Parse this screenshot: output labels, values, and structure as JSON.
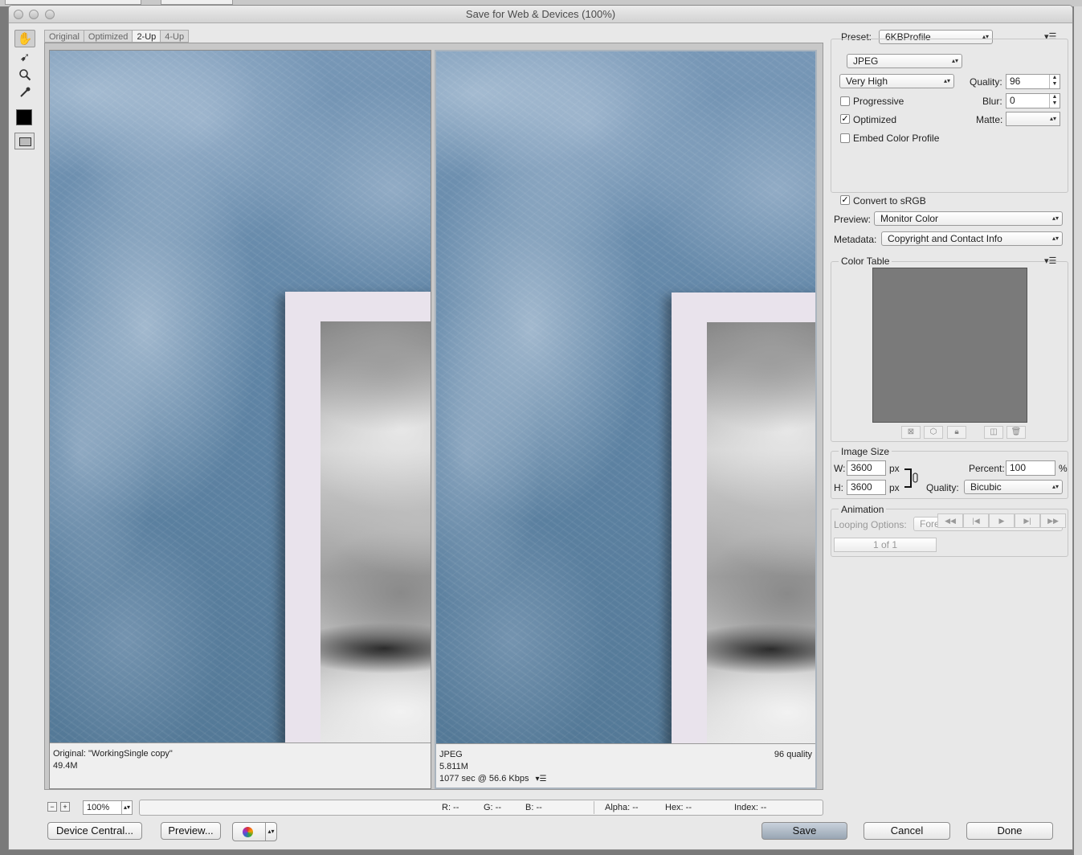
{
  "window": {
    "title": "Save for Web & Devices (100%)"
  },
  "tabs": [
    "Original",
    "Optimized",
    "2-Up",
    "4-Up"
  ],
  "active_tab": "2-Up",
  "tools": [
    "hand-tool",
    "slice-select-tool",
    "zoom-tool",
    "eyedropper-tool"
  ],
  "panes": {
    "left": {
      "line1": "Original: \"WorkingSingle copy\"",
      "line2": "49.4M"
    },
    "right": {
      "line1": "JPEG",
      "line2": "5.811M",
      "line3": "1077 sec @ 56.6 Kbps",
      "quality_note": "96 quality",
      "menu_glyph": "▾☰"
    }
  },
  "statusbar": {
    "zoom_out": "−",
    "zoom_in": "+",
    "zoom": "100%",
    "r": "R: --",
    "g": "G: --",
    "b": "B: --",
    "alpha": "Alpha: --",
    "hex": "Hex: --",
    "index": "Index: --"
  },
  "buttons": {
    "device_central": "Device Central...",
    "preview": "Preview...",
    "save": "Save",
    "cancel": "Cancel",
    "done": "Done"
  },
  "settings": {
    "preset_label": "Preset:",
    "preset": "6KBProfile",
    "format": "JPEG",
    "quality_preset": "Very High",
    "quality_label": "Quality:",
    "quality": "96",
    "blur_label": "Blur:",
    "blur": "0",
    "matte_label": "Matte:",
    "matte": "",
    "progressive_label": "Progressive",
    "progressive": false,
    "optimized_label": "Optimized",
    "optimized": true,
    "embed_label": "Embed Color Profile",
    "embed": false,
    "convert_label": "Convert to sRGB",
    "convert": true,
    "preview_label": "Preview:",
    "preview": "Monitor Color",
    "metadata_label": "Metadata:",
    "metadata": "Copyright and Contact Info"
  },
  "color_table": {
    "title": "Color Table",
    "fill": "#7a7a7a"
  },
  "image_size": {
    "title": "Image Size",
    "w_label": "W:",
    "w": "3600",
    "h_label": "H:",
    "h": "3600",
    "unit": "px",
    "percent_label": "Percent:",
    "percent": "100",
    "percent_unit": "%",
    "quality_label": "Quality:",
    "quality": "Bicubic"
  },
  "animation": {
    "title": "Animation",
    "looping_label": "Looping Options:",
    "looping": "Forever",
    "frame": "1 of 1"
  },
  "colors": {
    "sky_blue": "#5f84a5",
    "paper": "#e9e3ec",
    "window_bg": "#e8e8e8",
    "save_button": "#a9b5c2"
  }
}
